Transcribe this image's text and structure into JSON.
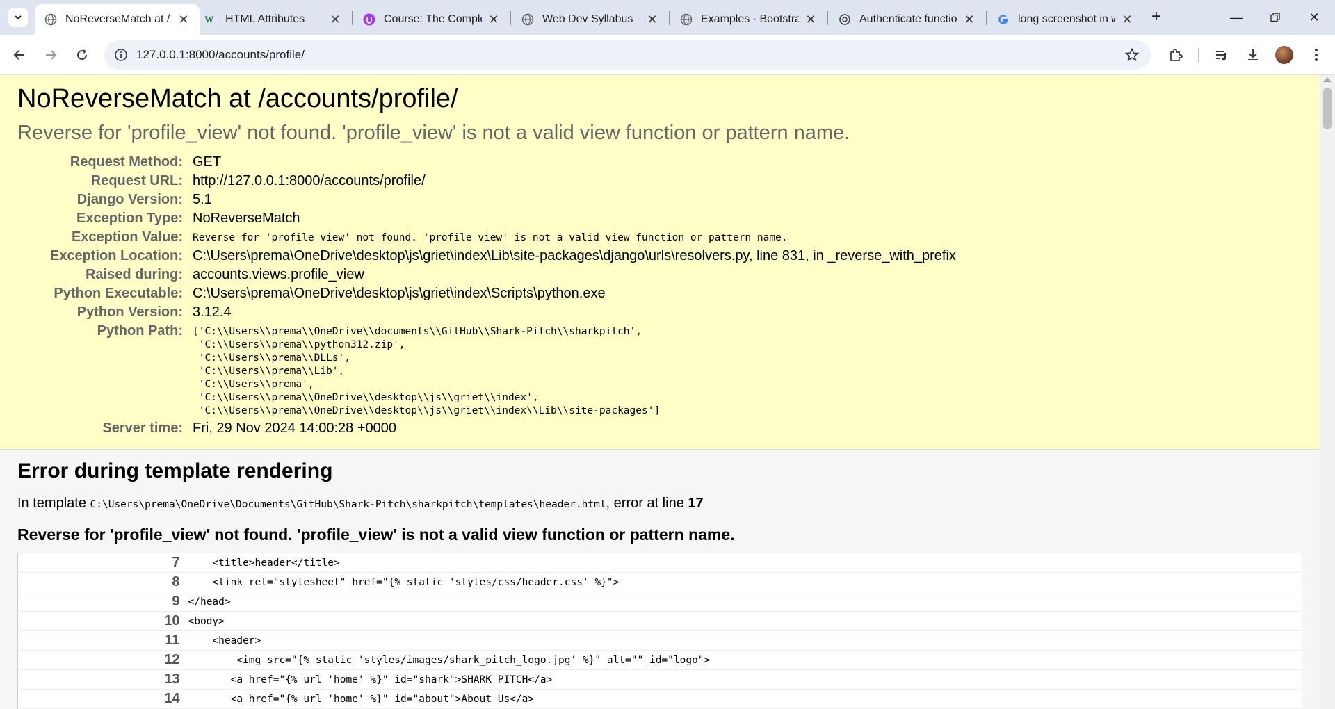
{
  "browser": {
    "tabs": [
      {
        "title": "NoReverseMatch at /",
        "icon": "globe-icon",
        "active": true
      },
      {
        "title": "HTML Attributes",
        "icon": "w3-logo-icon",
        "active": false
      },
      {
        "title": "Course: The Complet",
        "icon": "course-icon",
        "active": false
      },
      {
        "title": "Web Dev Syllabus",
        "icon": "globe-icon",
        "active": false
      },
      {
        "title": "Examples · Bootstrap",
        "icon": "globe-icon",
        "active": false
      },
      {
        "title": "Authenticate functio",
        "icon": "openai-icon",
        "active": false
      },
      {
        "title": "long screenshot in w",
        "icon": "google-icon",
        "active": false
      }
    ],
    "url": "127.0.0.1:8000/accounts/profile/"
  },
  "summary": {
    "title": "NoReverseMatch at /accounts/profile/",
    "subtitle": "Reverse for 'profile_view' not found. 'profile_view' is not a valid view function or pattern name.",
    "meta": [
      {
        "label": "Request Method:",
        "value": "GET"
      },
      {
        "label": "Request URL:",
        "value": "http://127.0.0.1:8000/accounts/profile/"
      },
      {
        "label": "Django Version:",
        "value": "5.1"
      },
      {
        "label": "Exception Type:",
        "value": "NoReverseMatch"
      },
      {
        "label": "Exception Value:",
        "value": "Reverse for 'profile_view' not found. 'profile_view' is not a valid view function or pattern name."
      },
      {
        "label": "Exception Location:",
        "value": "C:\\Users\\prema\\OneDrive\\desktop\\js\\griet\\index\\Lib\\site-packages\\django\\urls\\resolvers.py, line 831, in _reverse_with_prefix"
      },
      {
        "label": "Raised during:",
        "value": "accounts.views.profile_view"
      },
      {
        "label": "Python Executable:",
        "value": "C:\\Users\\prema\\OneDrive\\desktop\\js\\griet\\index\\Scripts\\python.exe"
      },
      {
        "label": "Python Version:",
        "value": "3.12.4"
      },
      {
        "label": "Python Path:",
        "value": "['C:\\\\Users\\\\prema\\\\OneDrive\\\\documents\\\\GitHub\\\\Shark-Pitch\\\\sharkpitch',\n 'C:\\\\Users\\\\prema\\\\python312.zip',\n 'C:\\\\Users\\\\prema\\\\DLLs',\n 'C:\\\\Users\\\\prema\\\\Lib',\n 'C:\\\\Users\\\\prema',\n 'C:\\\\Users\\\\prema\\\\OneDrive\\\\desktop\\\\js\\\\griet\\\\index',\n 'C:\\\\Users\\\\prema\\\\OneDrive\\\\desktop\\\\js\\\\griet\\\\index\\\\Lib\\\\site-packages']"
      },
      {
        "label": "Server time:",
        "value": "Fri, 29 Nov 2024 14:00:28 +0000"
      }
    ]
  },
  "template": {
    "heading": "Error during template rendering",
    "intro_prefix": "In template ",
    "intro_path": "C:\\Users\\prema\\OneDrive\\Documents\\GitHub\\Shark-Pitch\\sharkpitch\\templates\\header.html",
    "intro_suffix": ", error at line ",
    "error_line": "17",
    "message": "Reverse for 'profile_view' not found. 'profile_view' is not a valid view function or pattern name.",
    "lines": [
      {
        "num": "7",
        "code": "    <title>header</title>"
      },
      {
        "num": "8",
        "code": "    <link rel=\"stylesheet\" href=\"{% static 'styles/css/header.css' %}\">"
      },
      {
        "num": "9",
        "code": "</head>"
      },
      {
        "num": "10",
        "code": "<body>"
      },
      {
        "num": "11",
        "code": "    <header>"
      },
      {
        "num": "12",
        "code": "        <img src=\"{% static 'styles/images/shark_pitch_logo.jpg' %}\" alt=\"\" id=\"logo\">"
      },
      {
        "num": "13",
        "code": "       <a href=\"{% url 'home' %}\" id=\"shark\">SHARK PITCH</a>"
      },
      {
        "num": "14",
        "code": "       <a href=\"{% url 'home' %}\" id=\"about\">About Us</a>"
      }
    ]
  }
}
